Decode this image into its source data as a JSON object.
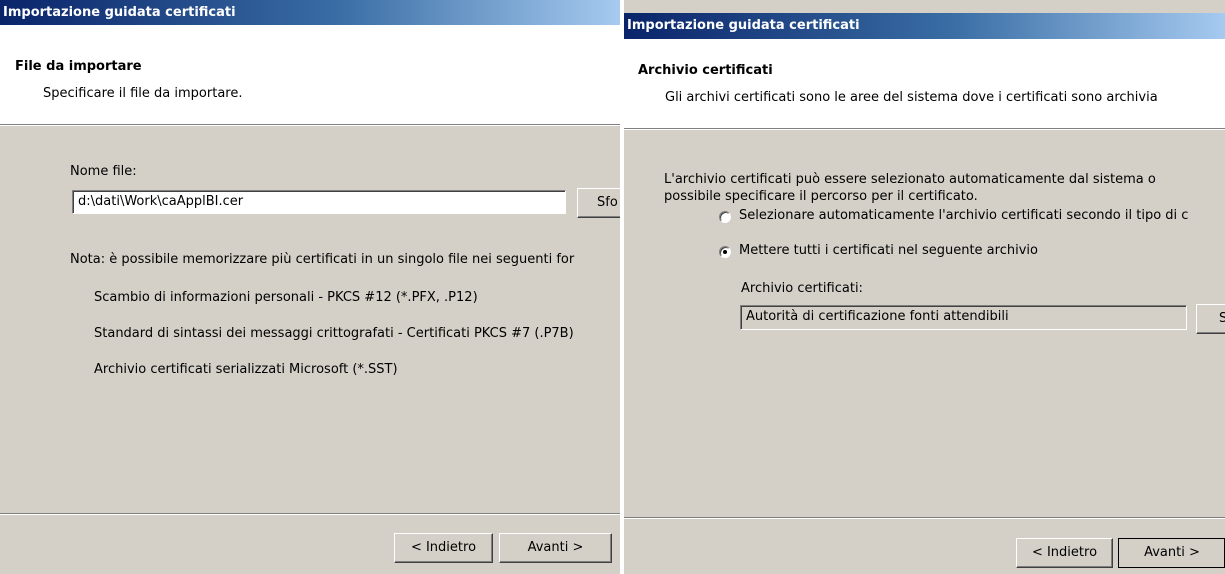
{
  "left": {
    "title": "Importazione guidata certificati",
    "header": {
      "heading": "File da importare",
      "subtitle": "Specificare il file da importare."
    },
    "filename_label": "Nome file:",
    "filename_value": "d:\\dati\\Work\\caApplBI.cer",
    "browse_label": "Sfo",
    "note": "Nota: è possibile memorizzare più certificati in un singolo file nei seguenti for",
    "formats": [
      "Scambio di informazioni personali - PKCS #12 (*.PFX, .P12)",
      "Standard di sintassi dei messaggi crittografati - Certificati PKCS #7 (.P7B)",
      "Archivio certificati serializzati Microsoft (*.SST)"
    ],
    "back_label": "< Indietro",
    "next_label": "Avanti >"
  },
  "right": {
    "title": "Importazione guidata certificati",
    "header": {
      "heading": "Archivio certificati",
      "subtitle": "Gli archivi certificati sono le aree del sistema dove i certificati sono archivia"
    },
    "description_line1": "L'archivio certificati può essere selezionato automaticamente dal sistema o",
    "description_line2": "possibile specificare il percorso per il certificato.",
    "radio_auto_label": "Selezionare automaticamente l'archivio certificati secondo il tipo di c",
    "radio_auto_selected": false,
    "radio_manual_label": "Mettere tutti i certificati nel seguente archivio",
    "radio_manual_selected": true,
    "store_label": "Archivio certificati:",
    "store_value": "Autorità di certificazione fonti attendibili",
    "browse_label": "S",
    "back_label": "< Indietro",
    "next_label": "Avanti >"
  }
}
